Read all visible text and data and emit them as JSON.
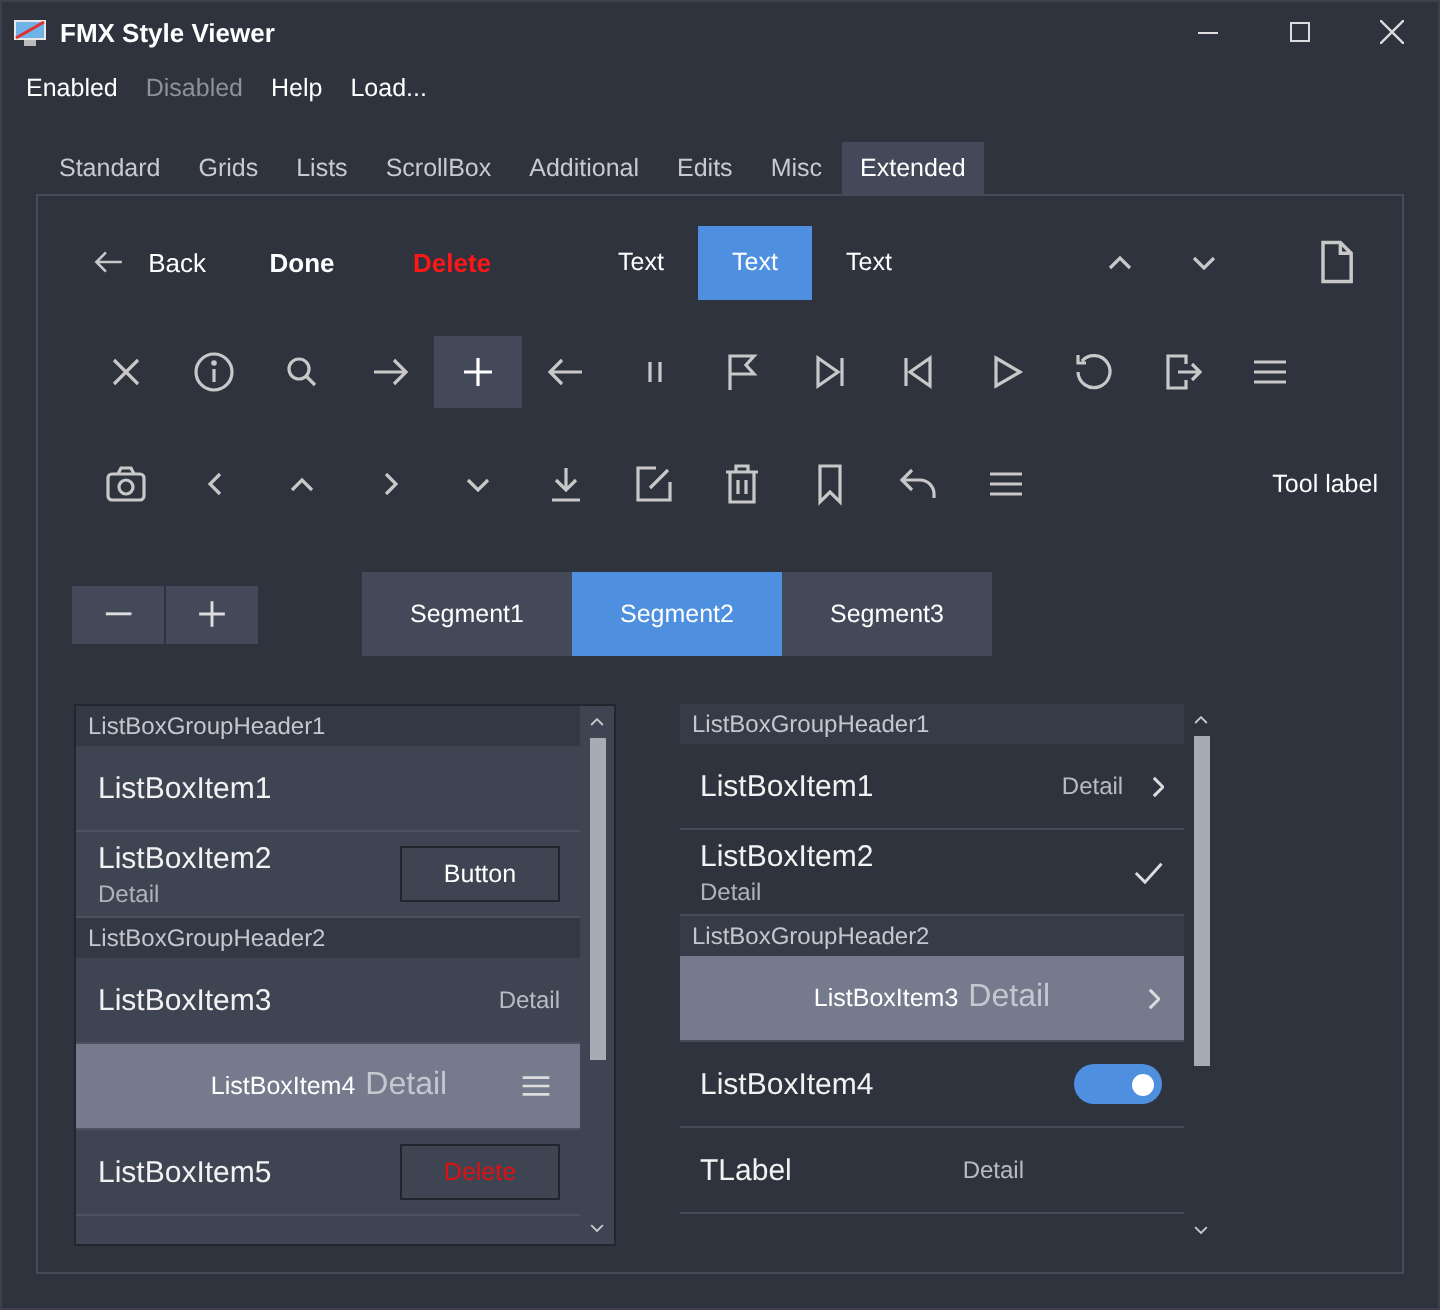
{
  "window": {
    "title": "FMX Style Viewer"
  },
  "menu": [
    {
      "label": "Enabled",
      "disabled": false
    },
    {
      "label": "Disabled",
      "disabled": true
    },
    {
      "label": "Help",
      "disabled": false
    },
    {
      "label": "Load...",
      "disabled": false
    }
  ],
  "tabs": [
    {
      "label": "Standard",
      "selected": false
    },
    {
      "label": "Grids",
      "selected": false
    },
    {
      "label": "Lists",
      "selected": false
    },
    {
      "label": "ScrollBox",
      "selected": false
    },
    {
      "label": "Additional",
      "selected": false
    },
    {
      "label": "Edits",
      "selected": false
    },
    {
      "label": "Misc",
      "selected": false
    },
    {
      "label": "Extended",
      "selected": true
    }
  ],
  "toolbar": {
    "back": "Back",
    "done": "Done",
    "delete": "Delete",
    "segments": [
      {
        "label": "Text",
        "selected": false
      },
      {
        "label": "Text",
        "selected": true
      },
      {
        "label": "Text",
        "selected": false
      }
    ]
  },
  "icon_row_1": [
    {
      "selected": false
    },
    {
      "selected": false
    },
    {
      "selected": false
    },
    {
      "selected": false
    },
    {
      "selected": true
    },
    {
      "selected": false
    },
    {
      "selected": false
    },
    {
      "selected": false
    },
    {
      "selected": false
    },
    {
      "selected": false
    },
    {
      "selected": false
    },
    {
      "selected": false
    },
    {
      "selected": false
    },
    {
      "selected": false
    }
  ],
  "icon_row_2": [
    {
      "selected": false
    },
    {
      "selected": false
    },
    {
      "selected": false
    },
    {
      "selected": false
    },
    {
      "selected": false
    },
    {
      "selected": false
    },
    {
      "selected": false
    },
    {
      "selected": false
    },
    {
      "selected": false
    },
    {
      "selected": false
    },
    {
      "selected": false
    }
  ],
  "tool_label": "Tool label",
  "segments": [
    {
      "label": "Segment1",
      "selected": false
    },
    {
      "label": "Segment2",
      "selected": true
    },
    {
      "label": "Segment3",
      "selected": false
    }
  ],
  "lists": [
    {
      "items": [
        {
          "kind": "header",
          "text": "ListBoxGroupHeader1"
        },
        {
          "kind": "item",
          "text": "ListBoxItem1",
          "selected": false
        },
        {
          "kind": "button",
          "text": "ListBoxItem2",
          "subtitle": "Detail",
          "button": {
            "kind": "normal",
            "label": "Button"
          },
          "selected": false
        },
        {
          "kind": "header",
          "text": "ListBoxGroupHeader2"
        },
        {
          "kind": "item",
          "text": "ListBoxItem3",
          "detail": "Detail",
          "selected": false
        },
        {
          "kind": "menu",
          "text": "ListBoxItem4",
          "detail": "Detail",
          "selected": true
        },
        {
          "kind": "button",
          "text": "ListBoxItem5",
          "button": {
            "kind": "destructive",
            "label": "Delete"
          },
          "selected": false
        }
      ]
    },
    {
      "items": [
        {
          "kind": "header",
          "text": "ListBoxGroupHeader1"
        },
        {
          "kind": "chevron",
          "text": "ListBoxItem1",
          "detail": "Detail",
          "selected": false
        },
        {
          "kind": "check",
          "text": "ListBoxItem2",
          "subtitle": "Detail",
          "selected": false
        },
        {
          "kind": "header",
          "text": "ListBoxGroupHeader2"
        },
        {
          "kind": "chevron",
          "text": "ListBoxItem3",
          "detail": "Detail",
          "selected": true
        },
        {
          "kind": "switch",
          "text": "ListBoxItem4",
          "on": true,
          "selected": false
        },
        {
          "kind": "label",
          "text": "TLabel",
          "detail": "Detail",
          "selected": false
        }
      ]
    }
  ]
}
